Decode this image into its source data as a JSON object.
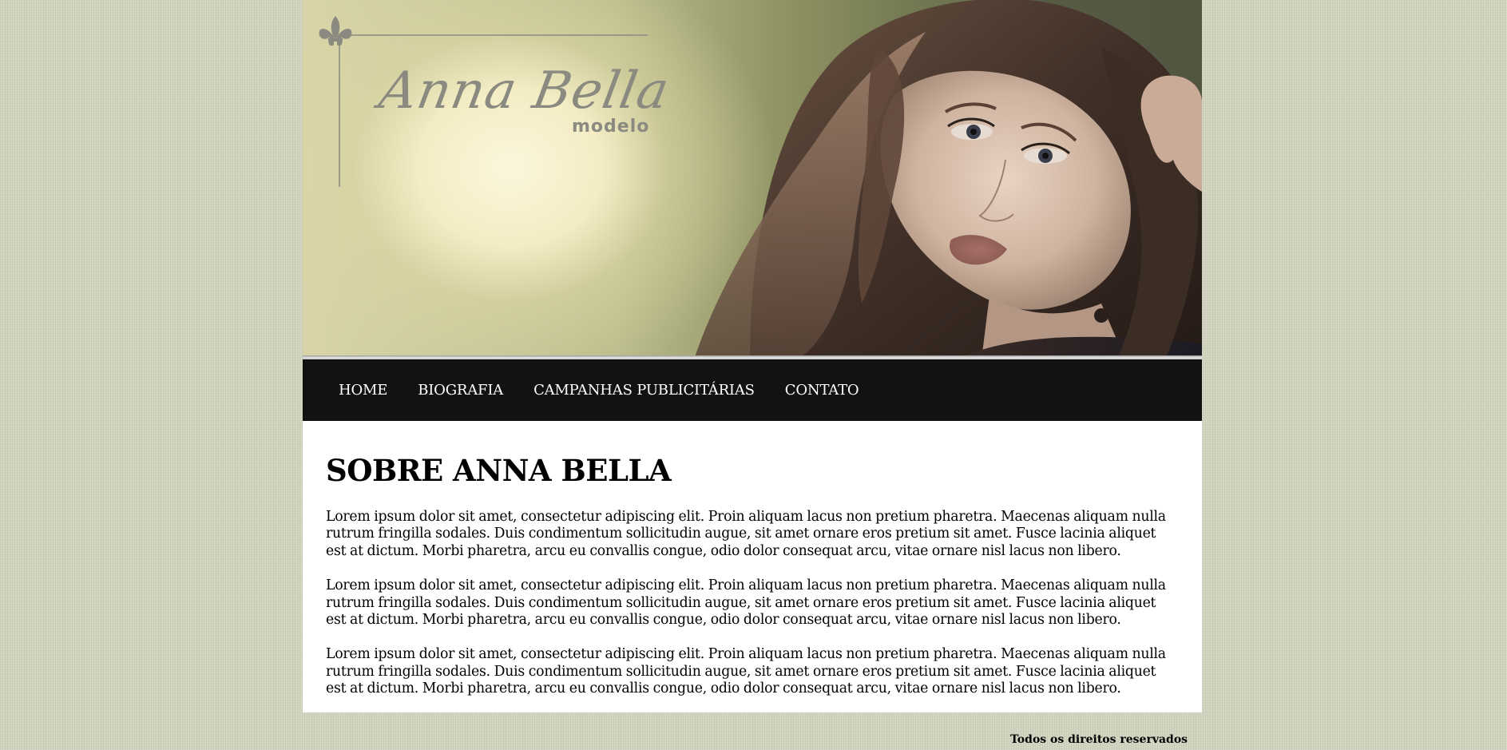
{
  "banner": {
    "logo_script": "Anna Bella",
    "logo_sub": "modelo",
    "photo_subject": "portrait-photo"
  },
  "nav": {
    "items": [
      {
        "label": "HOME"
      },
      {
        "label": "BIOGRAFIA"
      },
      {
        "label": "CAMPANHAS PUBLICITÁRIAS"
      },
      {
        "label": "CONTATO"
      }
    ]
  },
  "main": {
    "title": "SOBRE ANNA BELLA",
    "paragraphs": [
      "Lorem ipsum dolor sit amet, consectetur adipiscing elit. Proin aliquam lacus non pretium pharetra. Maecenas aliquam nulla rutrum fringilla sodales. Duis condimentum sollicitudin augue, sit amet ornare eros pretium sit amet. Fusce lacinia aliquet est at dictum. Morbi pharetra, arcu eu convallis congue, odio dolor consequat arcu, vitae ornare nisl lacus non libero.",
      "Lorem ipsum dolor sit amet, consectetur adipiscing elit. Proin aliquam lacus non pretium pharetra. Maecenas aliquam nulla rutrum fringilla sodales. Duis condimentum sollicitudin augue, sit amet ornare eros pretium sit amet. Fusce lacinia aliquet est at dictum. Morbi pharetra, arcu eu convallis congue, odio dolor consequat arcu, vitae ornare nisl lacus non libero.",
      "Lorem ipsum dolor sit amet, consectetur adipiscing elit. Proin aliquam lacus non pretium pharetra. Maecenas aliquam nulla rutrum fringilla sodales. Duis condimentum sollicitudin augue, sit amet ornare eros pretium sit amet. Fusce lacinia aliquet est at dictum. Morbi pharetra, arcu eu convallis congue, odio dolor consequat arcu, vitae ornare nisl lacus non libero."
    ]
  },
  "footer": {
    "text": "Todos os direitos reservados"
  },
  "colors": {
    "page_background": "#d3d4bf",
    "nav_background": "#131210",
    "nav_text": "#ffffff",
    "logo_color": "#8a8a80",
    "content_background": "#ffffff"
  }
}
